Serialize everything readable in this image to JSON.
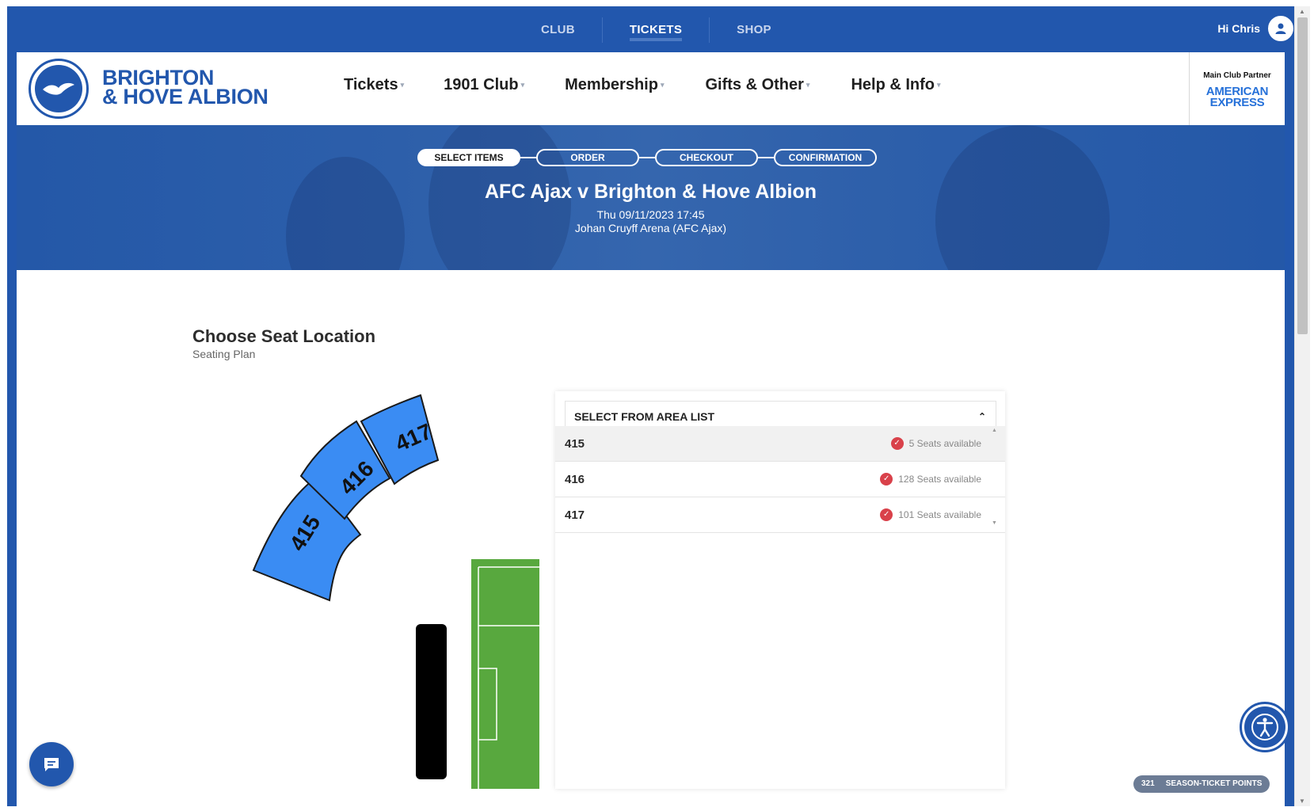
{
  "topnav": {
    "items": [
      {
        "label": "CLUB"
      },
      {
        "label": "TICKETS"
      },
      {
        "label": "SHOP"
      }
    ],
    "greeting": "Hi Chris"
  },
  "header": {
    "brand_line1": "BRIGHTON",
    "brand_line2": "& HOVE ALBION",
    "nav": [
      {
        "label": "Tickets"
      },
      {
        "label": "1901 Club"
      },
      {
        "label": "Membership"
      },
      {
        "label": "Gifts & Other"
      },
      {
        "label": "Help & Info"
      }
    ],
    "partner_label": "Main Club Partner",
    "partner_line1": "AMERICAN",
    "partner_line2": "EXPRESS"
  },
  "steps": [
    {
      "label": "SELECT ITEMS"
    },
    {
      "label": "ORDER"
    },
    {
      "label": "CHECKOUT"
    },
    {
      "label": "CONFIRMATION"
    }
  ],
  "match": {
    "title": "AFC Ajax v Brighton & Hove Albion",
    "date": "Thu 09/11/2023 17:45",
    "venue": "Johan Cruyff Arena (AFC Ajax)"
  },
  "seat_section": {
    "title": "Choose Seat Location",
    "subtitle": "Seating Plan",
    "blocks": [
      {
        "label": "415"
      },
      {
        "label": "416"
      },
      {
        "label": "417"
      }
    ]
  },
  "area_list": {
    "header": "SELECT FROM AREA LIST",
    "rows": [
      {
        "name": "415",
        "availability": "5 Seats available"
      },
      {
        "name": "416",
        "availability": "128 Seats available"
      },
      {
        "name": "417",
        "availability": "101 Seats available"
      }
    ]
  },
  "points": {
    "value": "321",
    "label": "SEASON-TICKET POINTS"
  },
  "colors": {
    "brand_blue": "#2257ad",
    "seat_block": "#3a8cf3",
    "pitch": "#58a83e",
    "available_check": "#d9414a"
  }
}
